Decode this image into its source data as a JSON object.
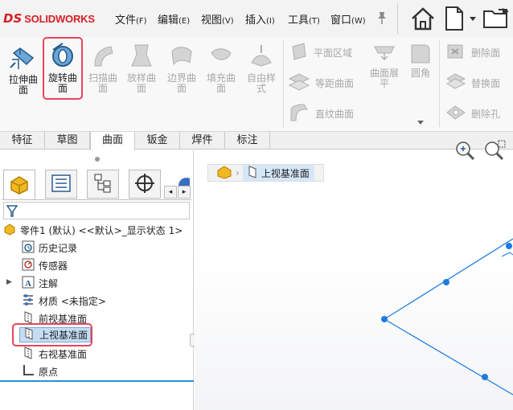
{
  "app": {
    "logo_mark": "DS",
    "logo_text": "SOLIDWORKS"
  },
  "menu": [
    {
      "label": "文件",
      "key": "(F)"
    },
    {
      "label": "编辑",
      "key": "(E)"
    },
    {
      "label": "视图",
      "key": "(V)"
    },
    {
      "label": "插入",
      "key": "(I)"
    },
    {
      "label": "工具",
      "key": "(T)"
    },
    {
      "label": "窗口",
      "key": "(W)"
    }
  ],
  "ribbon": {
    "extrude_surface": "拉伸曲面",
    "revolve_surface": "旋转曲面",
    "sweep_surface": "扫描曲面",
    "loft_surface": "放样曲面",
    "boundary_surface": "边界曲面",
    "fill_surface": "填充曲面",
    "freeform": "自由样式",
    "planar_surface": "平面区域",
    "offset_surface": "等距曲面",
    "ruled_surface": "直纹曲面",
    "flatten_surface": "曲面展平",
    "fillet": "圆角",
    "delete_face": "删除面",
    "replace_face": "替换面",
    "delete_hole": "删除孔"
  },
  "tabs": [
    "特征",
    "草图",
    "曲面",
    "钣金",
    "焊件",
    "标注"
  ],
  "active_tab": "曲面",
  "breadcrumb": {
    "item": "上视基准面"
  },
  "tree": {
    "part": "零件1 (默认) <<默认>_显示状态 1>",
    "history": "历史记录",
    "sensors": "传感器",
    "annotations": "注解",
    "material": "材质 <未指定>",
    "front_plane": "前视基准面",
    "top_plane": "上视基准面",
    "right_plane": "右视基准面",
    "origin": "原点"
  },
  "colors": {
    "accent_red": "#e8465a",
    "plane_blue": "#1e7be0",
    "selected_bg": "#c5ddf3"
  }
}
